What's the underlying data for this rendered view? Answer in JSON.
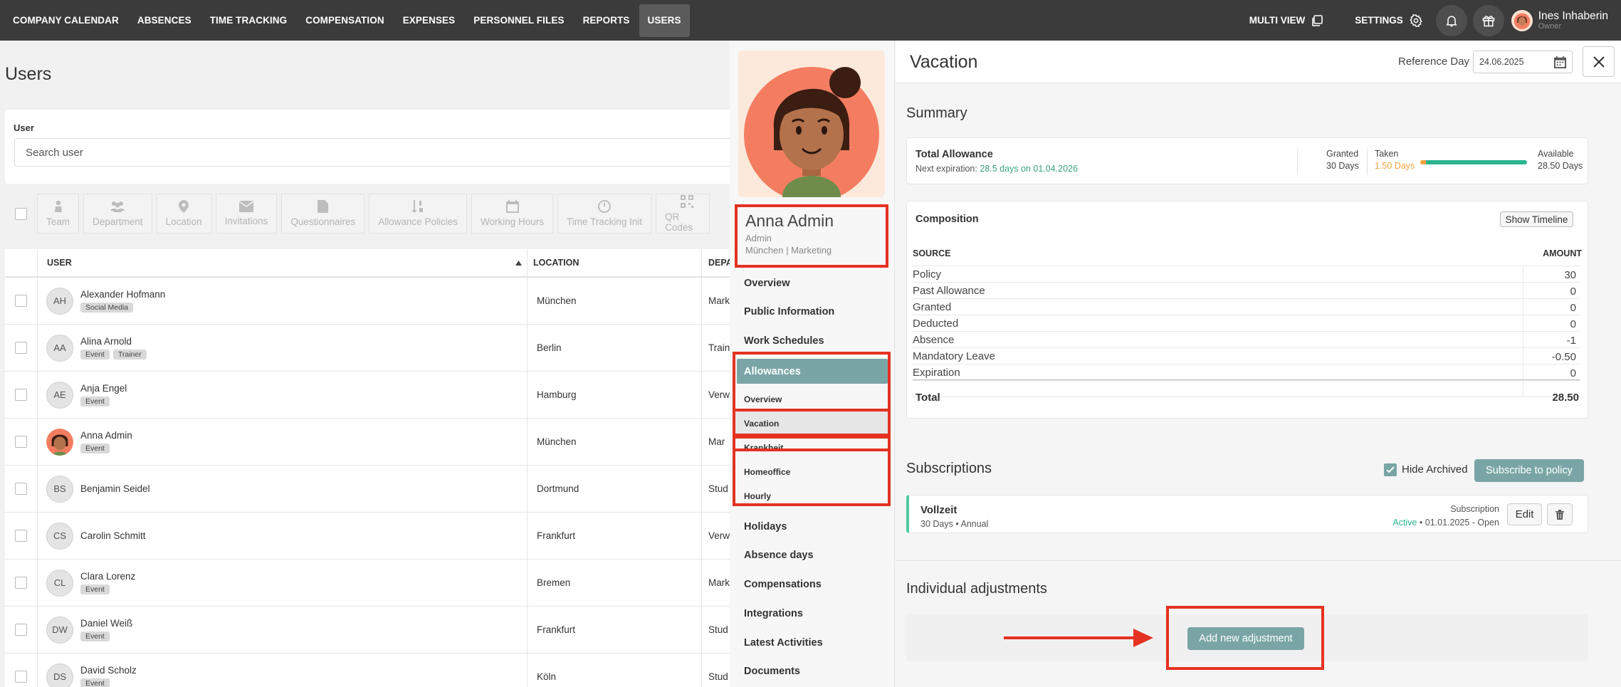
{
  "nav": {
    "items": [
      "COMPANY CALENDAR",
      "ABSENCES",
      "TIME TRACKING",
      "COMPENSATION",
      "EXPENSES",
      "PERSONNEL FILES",
      "REPORTS",
      "USERS"
    ],
    "multi_view": "MULTI VIEW",
    "settings": "SETTINGS",
    "user_name": "Ines Inhaberin",
    "user_role": "Owner"
  },
  "users": {
    "title": "Users",
    "search_label": "User",
    "search_placeholder": "Search user",
    "toolbar": [
      "Team",
      "Department",
      "Location",
      "Invitations",
      "Questionnaires",
      "Allowance Policies",
      "Working Hours",
      "Time Tracking Init",
      "QR Codes"
    ],
    "headers": {
      "user": "USER",
      "location": "LOCATION",
      "department": "DEPA"
    },
    "rows": [
      {
        "initials": "AH",
        "name": "Alexander Hofmann",
        "tags": [
          "Social Media"
        ],
        "location": "München",
        "dep": "Mark"
      },
      {
        "initials": "AA",
        "name": "Alina Arnold",
        "tags": [
          "Event",
          "Trainer"
        ],
        "location": "Berlin",
        "dep": "Train"
      },
      {
        "initials": "AE",
        "name": "Anja Engel",
        "tags": [
          "Event"
        ],
        "location": "Hamburg",
        "dep": "Verw"
      },
      {
        "initials": "",
        "name": "Anna Admin",
        "tags": [
          "Event"
        ],
        "location": "München",
        "dep": "Mar"
      },
      {
        "initials": "BS",
        "name": "Benjamin Seidel",
        "tags": [],
        "location": "Dortmund",
        "dep": "Stud"
      },
      {
        "initials": "CS",
        "name": "Carolin Schmitt",
        "tags": [],
        "location": "Frankfurt",
        "dep": "Verw"
      },
      {
        "initials": "CL",
        "name": "Clara Lorenz",
        "tags": [
          "Event"
        ],
        "location": "Bremen",
        "dep": "Mark"
      },
      {
        "initials": "DW",
        "name": "Daniel Weiß",
        "tags": [
          "Event"
        ],
        "location": "Frankfurt",
        "dep": "Stud"
      },
      {
        "initials": "DS",
        "name": "David Scholz",
        "tags": [
          "Event"
        ],
        "location": "Köln",
        "dep": "Stud"
      }
    ]
  },
  "profile": {
    "name": "Anna Admin",
    "role": "Admin",
    "location": "München | Marketing",
    "menu": [
      "Overview",
      "Public Information",
      "Work Schedules"
    ],
    "allowances": "Allowances",
    "sub": [
      "Overview",
      "Vacation",
      "Krankheit",
      "Homeoffice",
      "Hourly"
    ],
    "menu2": [
      "Holidays",
      "Absence days",
      "Compensations",
      "Integrations",
      "Latest Activities",
      "Documents"
    ]
  },
  "detail": {
    "title": "Vacation",
    "ref_label": "Reference Day",
    "ref_value": "24.06.2025",
    "summary_title": "Summary",
    "total_allowance": "Total Allowance",
    "next_exp_prefix": "Next expiration:",
    "next_exp_value": "28.5 days on 01.04.2026",
    "granted_label": "Granted",
    "granted_value": "30 Days",
    "taken_label": "Taken",
    "taken_value": "1.50 Days",
    "available_label": "Available",
    "available_value": "28.50 Days",
    "taken_fraction": 0.05,
    "composition_title": "Composition",
    "show_timeline": "Show Timeline",
    "col_source": "SOURCE",
    "col_amount": "AMOUNT",
    "comp_rows": [
      {
        "source": "Policy",
        "amount": "30"
      },
      {
        "source": "Past Allowance",
        "amount": "0"
      },
      {
        "source": "Granted",
        "amount": "0"
      },
      {
        "source": "Deducted",
        "amount": "0"
      },
      {
        "source": "Absence",
        "amount": "-1"
      },
      {
        "source": "Mandatory Leave",
        "amount": "-0.50"
      },
      {
        "source": "Expiration",
        "amount": "0"
      }
    ],
    "total_label": "Total",
    "total_value": "28.50",
    "subs_title": "Subscriptions",
    "hide_archived": "Hide Archived",
    "subscribe_btn": "Subscribe to policy",
    "sub_name": "Vollzeit",
    "sub_detail": "30 Days • Annual",
    "sub_label": "Subscription",
    "sub_status": "Active",
    "sub_date": "• 01.01.2025 - Open",
    "edit_btn": "Edit",
    "adj_title": "Individual adjustments",
    "add_adj_btn": "Add new adjustment"
  },
  "colors": {
    "accent": "#7aa5a6",
    "highlight": "#e53222",
    "active_green": "#2bb58f",
    "taken_orange": "#f0a340"
  }
}
